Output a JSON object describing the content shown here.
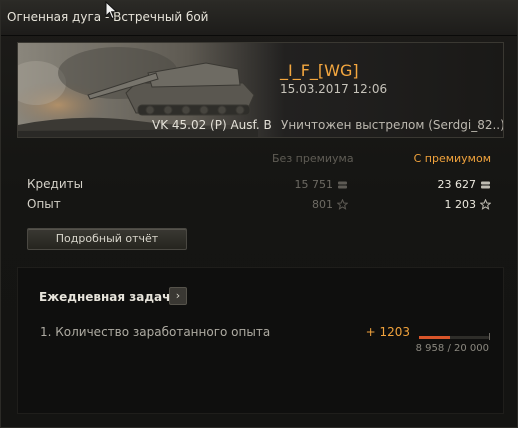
{
  "window": {
    "title_map": "Огненная дуга",
    "title_sep": " - ",
    "title_mode": "Встречный бой"
  },
  "battle": {
    "player_name": "_I_F_[WG]",
    "date": "15.03.2017 12:06",
    "tank_name": "VK 45.02 (P) Ausf. B",
    "kill_info": "Уничтожен выстрелом (Serdgi_82..)"
  },
  "results": {
    "col_basic": "Без премиума",
    "col_premium": "С премиумом",
    "rows": [
      {
        "label": "Кредиты",
        "basic": "15 751",
        "premium": "23 627",
        "icon": "credits-icon"
      },
      {
        "label": "Опыт",
        "basic": "801",
        "premium": "1 203",
        "icon": "star-icon"
      }
    ],
    "details_button": "Подробный отчёт"
  },
  "daily": {
    "title": "Ежедневная задача",
    "arrow": "›",
    "task_label": "1. Количество заработанного опыта",
    "gain": "+ 1203",
    "progress_text": "8 958 / 20 000",
    "progress_fraction": 0.4479
  },
  "colors": {
    "accent": "#f0a23c",
    "progress": "#d8552a",
    "background": "#141412"
  }
}
